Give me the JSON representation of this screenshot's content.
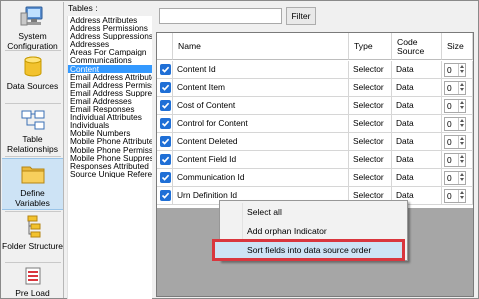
{
  "nav": {
    "items": [
      {
        "label": "System Configuration",
        "icon": "computer-icon"
      },
      {
        "label": "Data Sources",
        "icon": "database-icon"
      },
      {
        "label": "Table Relationships",
        "icon": "relationships-icon"
      },
      {
        "label": "Define Variables",
        "icon": "folder-icon"
      },
      {
        "label": "Folder Structure",
        "icon": "folder-structure-icon"
      },
      {
        "label": "Pre Load",
        "icon": "preload-icon"
      }
    ],
    "active_index": 3
  },
  "tables": {
    "label": "Tables :",
    "items": [
      "Address Attributes",
      "Address Permissions",
      "Address Suppressions",
      "Addresses",
      "Areas For Campaign",
      "Communications",
      "Content",
      "Email Address Attributes",
      "Email Address Permissions",
      "Email Address Suppressions",
      "Email Addresses",
      "Email Responses",
      "Individual Attributes",
      "Individuals",
      "Mobile Numbers",
      "Mobile Phone Attributes",
      "Mobile Phone Permissions",
      "Mobile Phone Suppressions",
      "Responses Attributed",
      "Source Unique References"
    ],
    "selected": "Content"
  },
  "filter": {
    "value": "",
    "button_label": "Filter"
  },
  "grid": {
    "columns": [
      "Name",
      "Type",
      "Code Source",
      "Size"
    ],
    "rows": [
      {
        "name": "Content Id",
        "type": "Selector",
        "code_source": "Data",
        "size": "0"
      },
      {
        "name": "Content Item",
        "type": "Selector",
        "code_source": "Data",
        "size": "0"
      },
      {
        "name": "Cost of Content",
        "type": "Selector",
        "code_source": "Data",
        "size": "0"
      },
      {
        "name": "Control for Content",
        "type": "Selector",
        "code_source": "Data",
        "size": "0"
      },
      {
        "name": "Content Deleted",
        "type": "Selector",
        "code_source": "Data",
        "size": "0"
      },
      {
        "name": "Content Field Id",
        "type": "Selector",
        "code_source": "Data",
        "size": "0"
      },
      {
        "name": "Communication Id",
        "type": "Selector",
        "code_source": "Data",
        "size": "0"
      },
      {
        "name": "Urn Definition Id",
        "type": "Selector",
        "code_source": "Data",
        "size": "0"
      }
    ]
  },
  "context_menu": {
    "items": [
      "Select all",
      "Add orphan Indicator",
      "Sort fields into data source order"
    ],
    "highlighted_index": 2
  },
  "colors": {
    "selection": "#3399ff",
    "checkbox": "#1f6fd6",
    "highlight_box": "#d9363e",
    "active_nav": "#cde3f5"
  }
}
